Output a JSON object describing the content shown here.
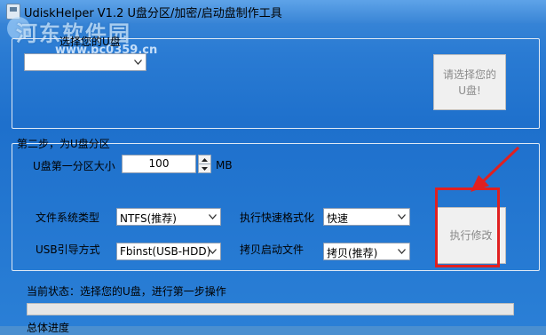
{
  "window": {
    "title": "UdiskHelper V1.2  U盘分区/加密/启动盘制作工具"
  },
  "watermark": {
    "text": "河东软件园",
    "url": "www.pc0359.cn"
  },
  "step1": {
    "label": "选择您的U盘",
    "disk_select_value": "",
    "choose_button_label": "请选择您的U盘!"
  },
  "step2": {
    "label": "第二步，为U盘分区",
    "partition_size_label": "U盘第一分区大小",
    "partition_size_value": "100",
    "partition_size_unit": "MB",
    "fs_label": "文件系统类型",
    "fs_value": "NTFS(推荐)",
    "quick_format_label": "执行快速格式化",
    "quick_format_value": "快速",
    "boot_label": "USB引导方式",
    "boot_value": "Fbinst(USB-HDD)",
    "copy_boot_label": "拷贝启动文件",
    "copy_boot_value": "拷贝(推荐)",
    "execute_button_label": "执行修改"
  },
  "status": {
    "current_status": "当前状态：选择您的U盘，进行第一步操作",
    "overall_progress_label": "总体进度",
    "progress_fraction": 0
  },
  "colors": {
    "annotation_red": "#e02020",
    "window_blue": "#2a7bd3"
  }
}
